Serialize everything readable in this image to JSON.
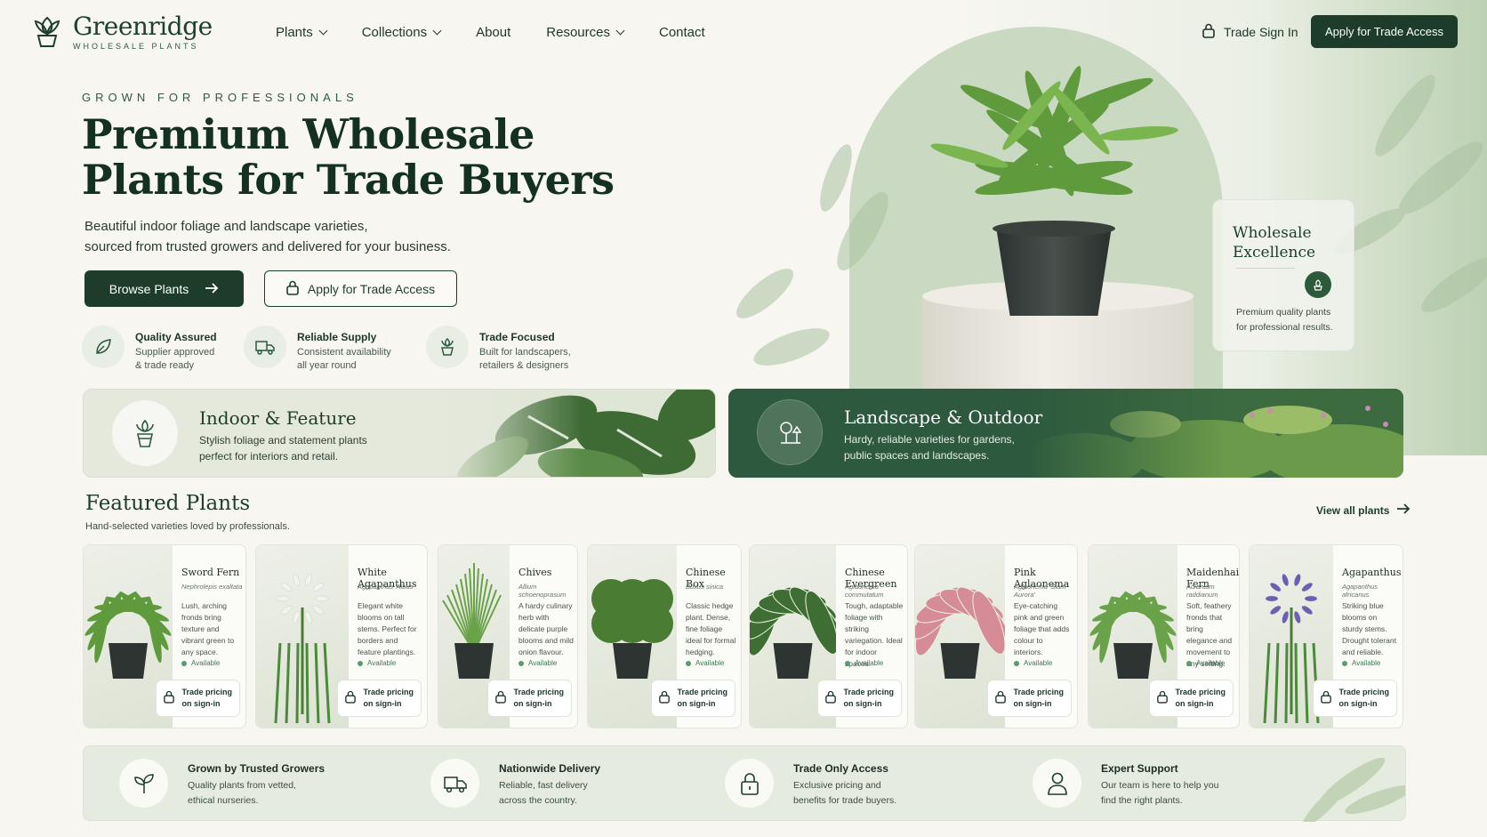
{
  "brand": {
    "name": "Greenridge",
    "tagline": "WHOLESALE PLANTS"
  },
  "nav": [
    {
      "label": "Plants",
      "dropdown": true
    },
    {
      "label": "Collections",
      "dropdown": true
    },
    {
      "label": "About",
      "dropdown": false
    },
    {
      "label": "Resources",
      "dropdown": true
    },
    {
      "label": "Contact",
      "dropdown": false
    }
  ],
  "header": {
    "trade_sign_in": "Trade Sign In",
    "apply_label": "Apply for Trade Access"
  },
  "hero": {
    "eyebrow": "GROWN FOR PROFESSIONALS",
    "title": "Premium Wholesale Plants for Trade Buyers",
    "subtitle_line1": "Beautiful indoor foliage and landscape varieties,",
    "subtitle_line2": "sourced from trusted growers and delivered for your business.",
    "browse_label": "Browse Plants",
    "apply_label": "Apply for Trade Access",
    "features": [
      {
        "title": "Quality Assured",
        "line1": "Supplier approved",
        "line2": "& trade ready",
        "icon": "leaf-icon"
      },
      {
        "title": "Reliable Supply",
        "line1": "Consistent availability",
        "line2": "all year round",
        "icon": "truck-icon"
      },
      {
        "title": "Trade Focused",
        "line1": "Built for landscapers,",
        "line2": "retailers & designers",
        "icon": "potted-plant-icon"
      }
    ],
    "excellence": {
      "title_line1": "Wholesale",
      "title_line2": "Excellence",
      "desc": "Premium quality plants for professional results."
    }
  },
  "categories": [
    {
      "title": "Indoor & Feature",
      "line1": "Stylish foliage and statement plants",
      "line2": "perfect for interiors and retail."
    },
    {
      "title": "Landscape & Outdoor",
      "line1": "Hardy, reliable varieties for gardens,",
      "line2": "public spaces and landscapes."
    }
  ],
  "featured": {
    "title": "Featured Plants",
    "subtitle": "Hand-selected varieties loved by professionals.",
    "view_all": "View all plants",
    "availability": "Available",
    "trade_line1": "Trade pricing",
    "trade_line2": "on sign-in",
    "plants": [
      {
        "name": "Sword Fern",
        "latin": "Nephrolepis exaltata",
        "desc": "Lush, arching fronds bring texture and vibrant green to any space."
      },
      {
        "name": "White Agapanthus",
        "latin": "Agapanthus 'Albus'",
        "desc": "Elegant white blooms on tall stems. Perfect for borders and feature plantings."
      },
      {
        "name": "Chives",
        "latin": "Allium schoenoprasum",
        "desc": "A hardy culinary herb with delicate purple blooms and mild onion flavour."
      },
      {
        "name": "Chinese Box",
        "latin": "Buxus sinica",
        "desc": "Classic hedge plant. Dense, fine foliage ideal for formal hedging."
      },
      {
        "name": "Chinese Evergreen",
        "latin": "Aglaonema commutatum",
        "desc": "Tough, adaptable foliage with striking variegation. Ideal for indoor spaces."
      },
      {
        "name": "Pink Aglaonema",
        "latin": "Aglaonema 'Siam Aurora'",
        "desc": "Eye-catching pink and green foliage that adds colour to interiors."
      },
      {
        "name": "Maidenhair Fern",
        "latin": "Adiantum raddianum",
        "desc": "Soft, feathery fronds that bring elegance and movement to any setting."
      },
      {
        "name": "Agapanthus",
        "latin": "Agapanthus africanus",
        "desc": "Striking blue blooms on sturdy stems. Drought tolerant and reliable."
      }
    ]
  },
  "benefits": [
    {
      "title": "Grown by Trusted Growers",
      "line1": "Quality plants from vetted,",
      "line2": "ethical nurseries.",
      "icon": "sprout-icon"
    },
    {
      "title": "Nationwide Delivery",
      "line1": "Reliable, fast delivery",
      "line2": "across the country.",
      "icon": "truck-icon"
    },
    {
      "title": "Trade Only Access",
      "line1": "Exclusive pricing and",
      "line2": "benefits  for trade buyers.",
      "icon": "lock-icon"
    },
    {
      "title": "Expert Support",
      "line1": "Our team is here to help you",
      "line2": "find the right plants.",
      "icon": "user-icon"
    }
  ],
  "colors": {
    "primary": "#1d3d2a",
    "accent": "#2d5a3e",
    "background": "#f7f6f1",
    "available": "#5a9a6c"
  }
}
